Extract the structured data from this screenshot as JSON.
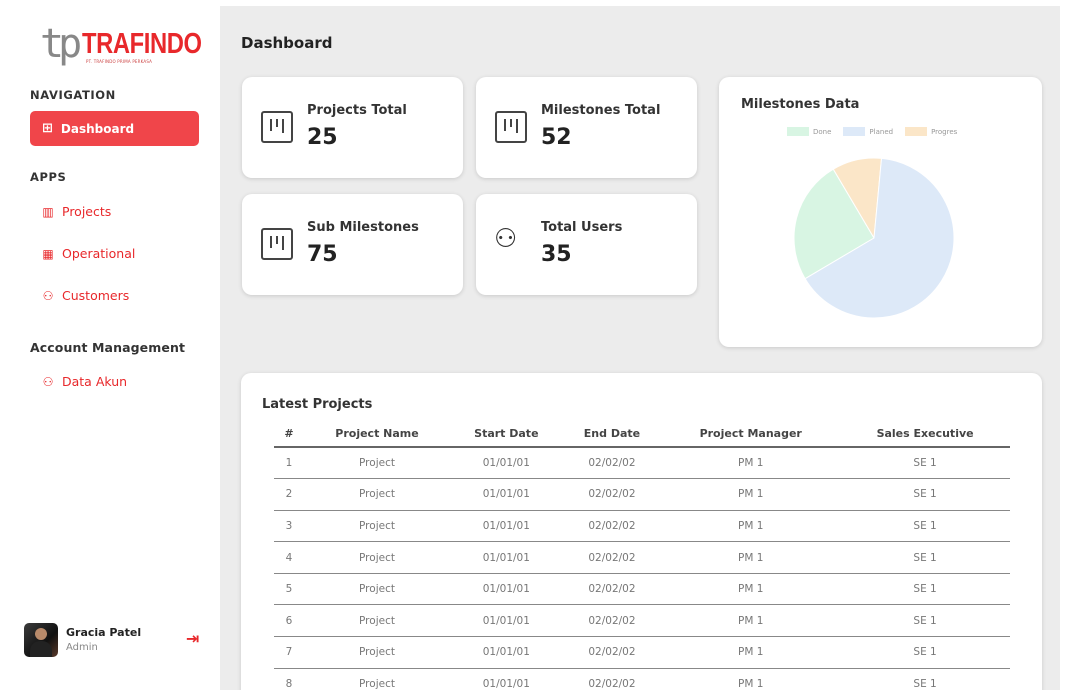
{
  "logo": {
    "mark": "tp",
    "name": "TRAFINDO",
    "tagline": "PT. TRAFINDO PRIMA PERKASA"
  },
  "sidebar": {
    "nav_title": "NAVIGATION",
    "active_item": {
      "label": "Dashboard",
      "icon": "grid-icon"
    },
    "apps_title": "APPS",
    "apps": [
      {
        "label": "Projects",
        "icon": "board-icon"
      },
      {
        "label": "Operational",
        "icon": "calendar-icon"
      },
      {
        "label": "Customers",
        "icon": "users-icon"
      }
    ],
    "account_title": "Account Management",
    "account_items": [
      {
        "label": "Data Akun",
        "icon": "users-icon"
      }
    ]
  },
  "user": {
    "name": "Gracia Patel",
    "role": "Admin",
    "logout_icon": "logout-icon"
  },
  "main": {
    "title": "Dashboard"
  },
  "stats": [
    {
      "label": "Projects Total",
      "value": "25",
      "icon": "board-icon"
    },
    {
      "label": "Milestones Total",
      "value": "52",
      "icon": "board-icon"
    },
    {
      "label": "Sub Milestones",
      "value": "75",
      "icon": "board-icon"
    },
    {
      "label": "Total Users",
      "value": "35",
      "icon": "users-icon"
    }
  ],
  "chart_data": {
    "type": "pie",
    "title": "Milestones Data",
    "legend_placement": "top",
    "categories": [
      "Done",
      "Planed",
      "Progres"
    ],
    "values": [
      25,
      65,
      10
    ],
    "colors": [
      "#d8f5e3",
      "#dde9f8",
      "#fbe6c8"
    ]
  },
  "table": {
    "title": "Latest Projects",
    "headers": [
      "#",
      "Project Name",
      "Start Date",
      "End Date",
      "Project Manager",
      "Sales Executive"
    ],
    "rows": [
      [
        "1",
        "Project",
        "01/01/01",
        "02/02/02",
        "PM 1",
        "SE 1"
      ],
      [
        "2",
        "Project",
        "01/01/01",
        "02/02/02",
        "PM 1",
        "SE 1"
      ],
      [
        "3",
        "Project",
        "01/01/01",
        "02/02/02",
        "PM 1",
        "SE 1"
      ],
      [
        "4",
        "Project",
        "01/01/01",
        "02/02/02",
        "PM 1",
        "SE 1"
      ],
      [
        "5",
        "Project",
        "01/01/01",
        "02/02/02",
        "PM 1",
        "SE 1"
      ],
      [
        "6",
        "Project",
        "01/01/01",
        "02/02/02",
        "PM 1",
        "SE 1"
      ],
      [
        "7",
        "Project",
        "01/01/01",
        "02/02/02",
        "PM 1",
        "SE 1"
      ],
      [
        "8",
        "Project",
        "01/01/01",
        "02/02/02",
        "PM 1",
        "SE 1"
      ]
    ]
  }
}
